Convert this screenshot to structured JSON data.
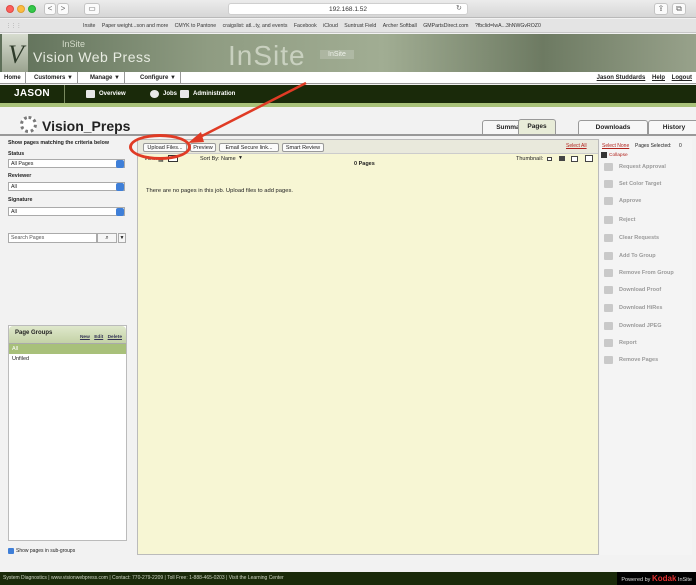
{
  "browser": {
    "url": "192.168.1.52",
    "bookmarks": [
      "Insite",
      "Paper weight...son and more",
      "CMYK to Pantone",
      "craigslist: atl...ty, and events",
      "Facebook",
      "iCloud",
      "Suntrust Field",
      "Archer Softball",
      "GMPartsDirect.com",
      "?fbclid=IwA...3hNWGvROZ0"
    ],
    "back_label": "<",
    "forward_label": ">"
  },
  "banner": {
    "brand": "Vision Web Press",
    "logo_letter": "V",
    "product_big": "InSite",
    "product_small": "InSite",
    "faint_text": "InSite"
  },
  "menu": {
    "items": [
      "Home",
      "Customers ▼",
      "Manage ▼",
      "Configure ▼"
    ],
    "user": "Jason Studdards",
    "help": "Help",
    "logout": "Logout"
  },
  "nav": {
    "job": "JASON",
    "items": [
      "Overview",
      "Jobs",
      "Administration"
    ]
  },
  "page": {
    "title": "Vision_Preps",
    "tabs": [
      "Summary",
      "Pages",
      "Downloads",
      "History"
    ],
    "active_tab": "Pages"
  },
  "filters": {
    "heading": "Show pages matching the criteria below",
    "status_label": "Status",
    "status_value": "All Pages",
    "reviewer_label": "Reviewer",
    "reviewer_value": "All",
    "signature_label": "Signature",
    "signature_value": "All",
    "search_placeholder": "Search Pages"
  },
  "page_groups": {
    "title": "Page Groups",
    "actions": [
      "New",
      "Edit",
      "Delete"
    ],
    "items": [
      "All",
      "Unfiled"
    ],
    "subgroups_label": "Show pages in sub-groups"
  },
  "toolbar": {
    "upload": "Upload Files...",
    "preview": "Preview",
    "email": "Email Secure link...",
    "smart": "Smart Review",
    "view_label": "View:",
    "sort_label": "Sort By:",
    "sort_value": "Name",
    "pages_count": "0 Pages",
    "thumbnail_label": "Thumbnail:",
    "empty_message": "There are no pages in this job. Upload files to add pages."
  },
  "right_panel": {
    "select_all": "Select All",
    "select_none": "Select None",
    "pages_selected": "Pages Selected:",
    "pages_selected_count": "0",
    "collapse": "Collapse",
    "actions": [
      "Request Approval",
      "Set Color Target",
      "Approve",
      "Reject",
      "Clear Requests",
      "Add To Group",
      "Remove From Group",
      "Download Proof",
      "Download HiRes",
      "Download JPEG",
      "Report",
      "Remove Pages"
    ]
  },
  "footer": {
    "text": "System Diagnostics  |  www.visionwebpress.com  |  Contact: 770-279-2209  |  Toll Free: 1-888-465-0203  |  Visit the Learning Center",
    "powered": "Powered by",
    "kodak": "Kodak",
    "insite": "InSite"
  },
  "colors": {
    "nav_bg": "#1a2a0a",
    "accent_green": "#a9c27a",
    "annotation_red": "#e03b25",
    "link_red": "#b1221c"
  }
}
